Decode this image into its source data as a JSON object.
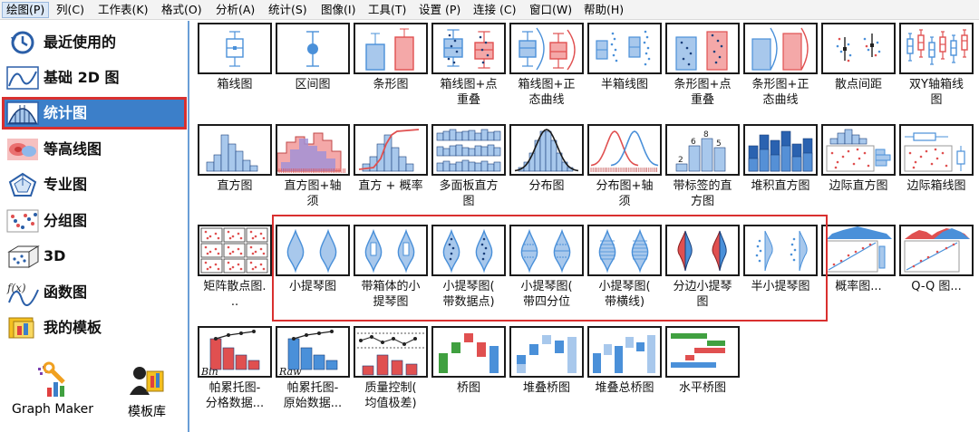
{
  "menu": [
    "绘图(P)",
    "列(C)",
    "工作表(K)",
    "格式(O)",
    "分析(A)",
    "统计(S)",
    "图像(I)",
    "工具(T)",
    "设置 (P)",
    "连接 (C)",
    "窗口(W)",
    "帮助(H)"
  ],
  "sidebar": {
    "items": [
      {
        "label": "最近使用的",
        "icon": "recent-icon"
      },
      {
        "label": "基础 2D 图",
        "icon": "basic-2d-icon"
      },
      {
        "label": "统计图",
        "icon": "statistics-icon"
      },
      {
        "label": "等高线图",
        "icon": "contour-icon"
      },
      {
        "label": "专业图",
        "icon": "specialized-icon"
      },
      {
        "label": "分组图",
        "icon": "grouped-icon"
      },
      {
        "label": "3D",
        "icon": "3d-icon"
      },
      {
        "label": "函数图",
        "icon": "function-icon"
      },
      {
        "label": "我的模板",
        "icon": "templates-icon"
      }
    ],
    "selected_index": 2,
    "graph_maker": "Graph Maker",
    "template_library": "模板库"
  },
  "gallery": {
    "rows": [
      [
        {
          "label": "箱线图",
          "kind": "box"
        },
        {
          "label": "区间图",
          "kind": "interval"
        },
        {
          "label": "条形图",
          "kind": "bar"
        },
        {
          "label": "箱线图+点\n重叠",
          "kind": "box-dots"
        },
        {
          "label": "箱线图+正\n态曲线",
          "kind": "box-normal"
        },
        {
          "label": "半箱线图",
          "kind": "half-box"
        },
        {
          "label": "条形图+点\n重叠",
          "kind": "bar-dots"
        },
        {
          "label": "条形图+正\n态曲线",
          "kind": "bar-normal"
        },
        {
          "label": "散点间距",
          "kind": "scatter-interval"
        },
        {
          "label": "双Y轴箱线\n图",
          "kind": "double-y-box"
        }
      ],
      [
        {
          "label": "直方图",
          "kind": "histogram"
        },
        {
          "label": "直方图+轴\n须",
          "kind": "histogram-rug"
        },
        {
          "label": "直方 + 概率",
          "kind": "histogram-prob"
        },
        {
          "label": "多面板直方\n图",
          "kind": "multi-panel"
        },
        {
          "label": "分布图",
          "kind": "distribution"
        },
        {
          "label": "分布图+轴\n须",
          "kind": "distribution-rug"
        },
        {
          "label": "带标签的直\n方图",
          "kind": "labeled-histogram"
        },
        {
          "label": "堆积直方图",
          "kind": "stacked-histogram"
        },
        {
          "label": "边际直方图",
          "kind": "marginal-histogram"
        },
        {
          "label": "边际箱线图",
          "kind": "marginal-box"
        }
      ],
      [
        {
          "label": "矩阵散点图.\n..",
          "kind": "scatter-matrix"
        },
        {
          "label": "小提琴图",
          "kind": "violin"
        },
        {
          "label": "带箱体的小\n提琴图",
          "kind": "violin-box"
        },
        {
          "label": "小提琴图(\n带数据点)",
          "kind": "violin-points"
        },
        {
          "label": "小提琴图(\n带四分位",
          "kind": "violin-quartile"
        },
        {
          "label": "小提琴图(\n带横线)",
          "kind": "violin-stick"
        },
        {
          "label": "分边小提琴\n图",
          "kind": "split-violin"
        },
        {
          "label": "半小提琴图",
          "kind": "half-violin"
        },
        {
          "label": "概率图...",
          "kind": "probability"
        },
        {
          "label": "Q-Q 图...",
          "kind": "qq"
        }
      ],
      [
        {
          "label": "帕累托图-\n分格数据...",
          "kind": "pareto-binned"
        },
        {
          "label": "帕累托图-\n原始数据...",
          "kind": "pareto-raw"
        },
        {
          "label": "质量控制(\n均值极差)",
          "kind": "qc"
        },
        {
          "label": "桥图",
          "kind": "waterfall"
        },
        {
          "label": "堆叠桥图",
          "kind": "stacked-waterfall"
        },
        {
          "label": "堆叠总桥图",
          "kind": "stacked-total-waterfall"
        },
        {
          "label": "水平桥图",
          "kind": "horizontal-waterfall"
        }
      ]
    ],
    "selected": "箱线图",
    "thumb_text": {
      "bin": "Bin",
      "raw": "Raw",
      "labeled_values": [
        "2",
        "6",
        "8",
        "5"
      ]
    }
  },
  "colors": {
    "accent": "#3c7fc9",
    "highlight": "#d9302f",
    "blue": "#4a90d9",
    "red": "#e05050",
    "light_blue": "#a8c8ec",
    "light_red": "#f4a8a8"
  }
}
